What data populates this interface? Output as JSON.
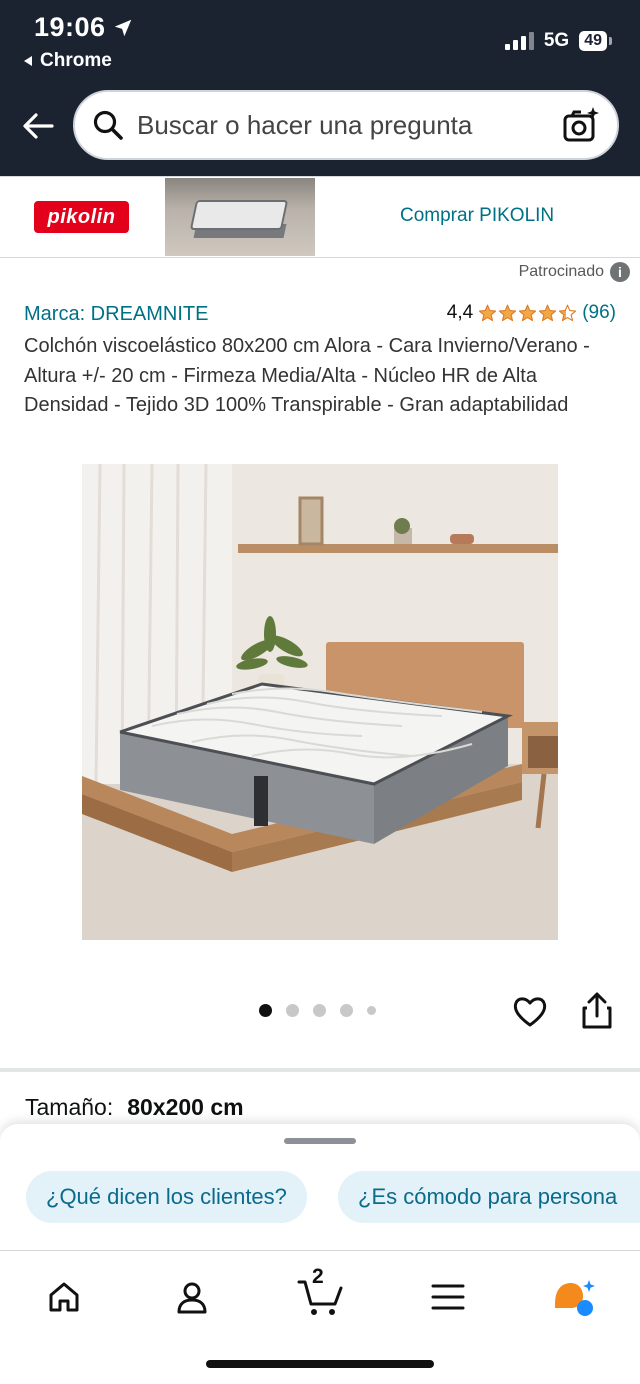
{
  "status_bar": {
    "time": "19:06",
    "back_app": "Chrome",
    "network": "5G",
    "battery": "49"
  },
  "search": {
    "placeholder": "Buscar o hacer una pregunta"
  },
  "banner": {
    "brand_logo_text": "pikolin",
    "link": "Comprar PIKOLIN",
    "sponsored": "Patrocinado"
  },
  "product": {
    "brand": "Marca: DREAMNITE",
    "rating": "4,4",
    "rating_value": 4.4,
    "review_count": "(96)",
    "title": "Colchón viscoelástico 80x200 cm Alora - Cara Invierno/Verano - Altura +/- 20 cm - Firmeza Media/Alta - Núcleo HR de Alta Densidad - Tejido 3D 100% Transpirable - Gran adaptabilidad",
    "image_count": 5,
    "active_image": 1,
    "size_label": "Tamaño:",
    "size_value": "80x200 cm"
  },
  "sheet": {
    "chips": [
      "¿Qué dicen los clientes?",
      "¿Es cómodo para persona"
    ]
  },
  "nav": {
    "items": [
      "home-icon",
      "account-icon",
      "cart-icon",
      "menu-icon",
      "rufus-icon"
    ],
    "cart_count": "2"
  },
  "colors": {
    "header_bg": "#1b2230",
    "link": "#007185",
    "star": "#f3a847",
    "brand_red": "#e3001b",
    "chip_bg": "#e3f1f9",
    "rufus_orange": "#f38a1b",
    "rufus_blue": "#1a8cff"
  }
}
